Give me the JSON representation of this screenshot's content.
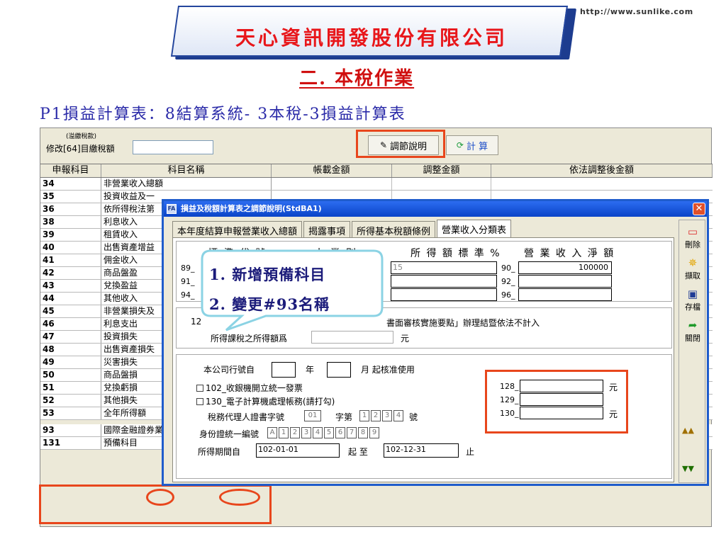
{
  "site_url": "http://www.sunlike.com",
  "company": "天心資訊開發股份有限公司",
  "section_title": "二. 本稅作業",
  "subtitle": "P1損益計算表：8結算系統- 3本稅-3損益計算表",
  "toolbar": {
    "small_label": "(溢繳稅款)",
    "label": "修改[64]目繳稅額",
    "input_value": "",
    "note_button": "調節說明",
    "calc_button": "計 算"
  },
  "grid": {
    "columns": [
      "申報科目",
      "科目名稱",
      "帳載金額",
      "調整金額",
      "依法調整後金額"
    ],
    "rows": [
      {
        "code": "34",
        "name": "非營業收入總額"
      },
      {
        "code": "35",
        "name": "投資收益及一"
      },
      {
        "code": "36",
        "name": "依所得稅法第"
      },
      {
        "code": "38",
        "name": "利息收入"
      },
      {
        "code": "39",
        "name": "租賃收入"
      },
      {
        "code": "40",
        "name": "出售資產增益"
      },
      {
        "code": "41",
        "name": "佣金收入"
      },
      {
        "code": "42",
        "name": "商品盤盈"
      },
      {
        "code": "43",
        "name": "兌換盈益"
      },
      {
        "code": "44",
        "name": "其他收入"
      },
      {
        "code": "45",
        "name": "非營業損失及"
      },
      {
        "code": "46",
        "name": "利息支出"
      },
      {
        "code": "47",
        "name": "投資損失"
      },
      {
        "code": "48",
        "name": "出售資產損失"
      },
      {
        "code": "49",
        "name": "災害損失"
      },
      {
        "code": "50",
        "name": "商品盤損"
      },
      {
        "code": "51",
        "name": "兌換虧損"
      },
      {
        "code": "52",
        "name": "其他損失"
      },
      {
        "code": "53",
        "name": "全年所得額"
      },
      {
        "code": "93",
        "name": "國際金融證券業務分行(分公司)免"
      },
      {
        "code": "131",
        "name": "預備科目"
      }
    ]
  },
  "dialog": {
    "title": "損益及稅額計算表之調節說明(StdBA1)",
    "tabs": [
      "本年度結算申報營業收入總額",
      "揭露事項",
      "所得基本稅額條例",
      "營業收入分類表"
    ],
    "header": {
      "col_a": "標 準 代 號",
      "col_b": "小 業 別",
      "col_c": "所 得 額 標 準 %",
      "col_d": "營 業 收 入 淨 額"
    },
    "codes_left": [
      "89_",
      "91_",
      "94_"
    ],
    "rate_placeholder": "15",
    "codes_right": [
      "90_",
      "92_",
      "96_"
    ],
    "net_revenue_first": "100000",
    "g2_prefix": "12",
    "g2_text": "書面審核實施要點」辦理結暨依法不計入",
    "g2_label": "所得課稅之所得額爲",
    "unit": "元",
    "company_period_label": "本公司行號自",
    "year_label": "年",
    "month_label": "月 起核准使用",
    "check1": "102_收銀機開立統一發票",
    "check2": "130_電子計算機處理帳務(請打勾)",
    "agent_label": "稅務代理人證書字號",
    "agent_prefix": "01",
    "agent_mid": "字第",
    "agent_digits": [
      "1",
      "2",
      "3",
      "4"
    ],
    "agent_suffix": "號",
    "id_label": "身份證統一編號",
    "id_chars": [
      "A",
      "1",
      "2",
      "3",
      "4",
      "5",
      "6",
      "7",
      "8",
      "9"
    ],
    "period_label": "所得期間自",
    "period_from": "102-01-01",
    "period_mid": "起 至",
    "period_to": "102-12-31",
    "period_end": "止",
    "new_codes": [
      "128_",
      "129_",
      "130_"
    ],
    "side_buttons": [
      "刪除",
      "擷取",
      "存檔",
      "關閉"
    ]
  },
  "callout": {
    "line1": "1. 新增預備科目",
    "line2": "2. 變更#93名稱"
  },
  "colors": {
    "highlight": "#e8461c",
    "banner_text": "#e8161a",
    "title_bar": "#0a44c8"
  }
}
